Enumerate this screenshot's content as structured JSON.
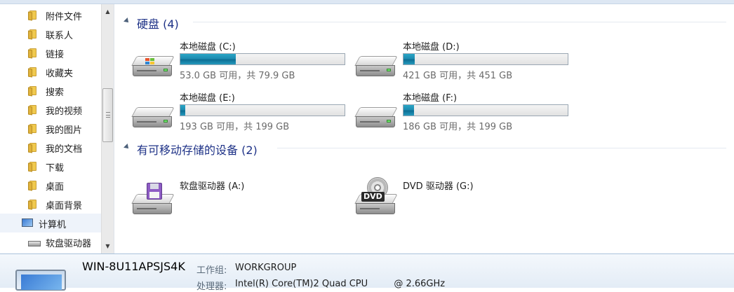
{
  "sidebar": {
    "items": [
      {
        "label": "附件文件",
        "icon": "folder-icon"
      },
      {
        "label": "联系人",
        "icon": "contacts-folder-icon"
      },
      {
        "label": "链接",
        "icon": "links-folder-icon"
      },
      {
        "label": "收藏夹",
        "icon": "favorites-folder-icon"
      },
      {
        "label": "搜索",
        "icon": "search-folder-icon"
      },
      {
        "label": "我的视频",
        "icon": "videos-folder-icon"
      },
      {
        "label": "我的图片",
        "icon": "pictures-folder-icon"
      },
      {
        "label": "我的文档",
        "icon": "documents-folder-icon"
      },
      {
        "label": "下载",
        "icon": "downloads-folder-icon"
      },
      {
        "label": "桌面",
        "icon": "desktop-folder-icon"
      },
      {
        "label": "桌面背景",
        "icon": "folder-icon"
      }
    ],
    "computer": {
      "label": "计算机",
      "icon": "computer-icon"
    },
    "floppy": {
      "label": "软盘驱动器",
      "icon": "floppy-drive-icon"
    }
  },
  "main": {
    "groups": [
      {
        "title": "硬盘 (4)",
        "drives": [
          {
            "name": "本地磁盘 (C:)",
            "info": "53.0 GB 可用，共 79.9 GB",
            "used_fraction": 0.337,
            "system": true
          },
          {
            "name": "本地磁盘 (D:)",
            "info": "421 GB 可用，共 451 GB",
            "used_fraction": 0.067
          },
          {
            "name": "本地磁盘 (E:)",
            "info": "193 GB 可用，共 199 GB",
            "used_fraction": 0.03
          },
          {
            "name": "本地磁盘 (F:)",
            "info": "186 GB 可用，共 199 GB",
            "used_fraction": 0.065
          }
        ]
      },
      {
        "title": "有可移动存储的设备 (2)",
        "drives": [
          {
            "name": "软盘驱动器 (A:)",
            "icon": "floppy-drive-icon"
          },
          {
            "name": "DVD 驱动器 (G:)",
            "icon": "dvd-drive-icon",
            "badge": "DVD"
          }
        ]
      }
    ]
  },
  "details": {
    "computer_name": "WIN-8U11APSJS4K",
    "workgroup_label": "工作组:",
    "workgroup_value": "WORKGROUP",
    "processor_label": "处理器:",
    "processor_value": "Intel(R) Core(TM)2 Quad CPU         @ 2.66GHz"
  },
  "colors": {
    "accent_title": "#1e3287",
    "progress_fill": "#1d8bb0",
    "selected_bg": "#eef3fa"
  }
}
